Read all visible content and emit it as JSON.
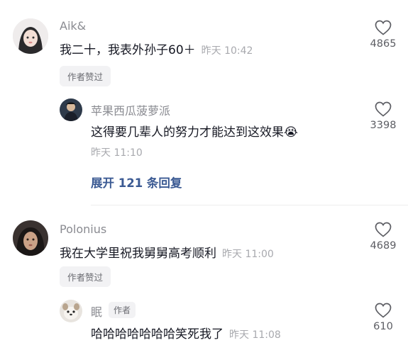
{
  "comments": [
    {
      "username": "Aik&",
      "text": "我二十，我表外孙子60＋",
      "time": "昨天 10:42",
      "badge": "作者赞过",
      "likes": "4865",
      "replies": [
        {
          "username": "苹果西瓜菠萝派",
          "text": "这得要几辈人的努力才能达到这效果",
          "emoji": "😭",
          "time": "昨天 11:10",
          "likes": "3398"
        }
      ],
      "expand_label": "展开 121 条回复"
    },
    {
      "username": "Polonius",
      "text": "我在大学里祝我舅舅高考顺利",
      "time": "昨天 11:00",
      "badge": "作者赞过",
      "likes": "4689",
      "replies": [
        {
          "username": "眠",
          "author_tag": "作者",
          "text": "哈哈哈哈哈哈哈笑死我了",
          "time": "昨天 11:08",
          "likes": "610"
        }
      ]
    }
  ],
  "icons": {
    "like": "heart-outline-icon"
  }
}
